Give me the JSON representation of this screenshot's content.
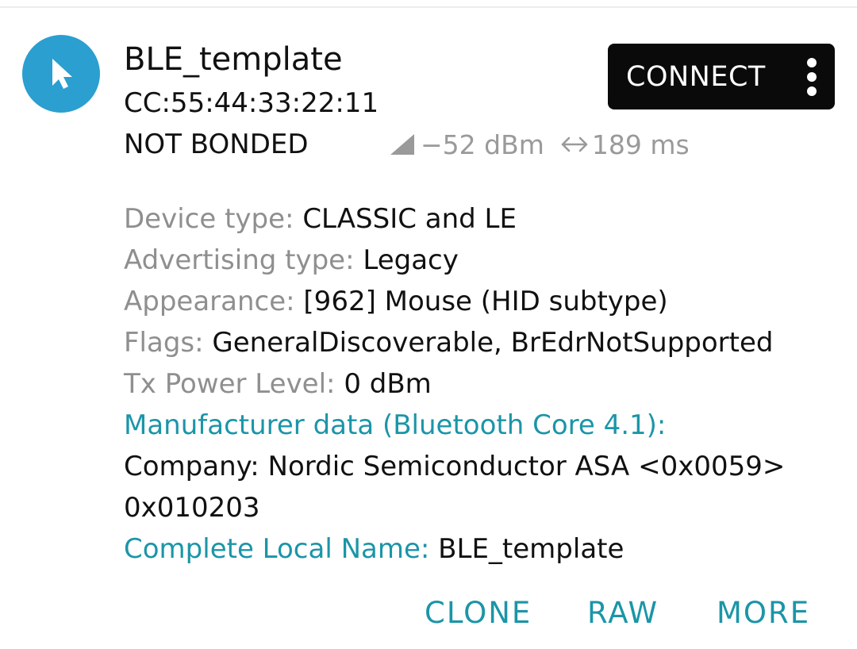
{
  "device": {
    "name": "BLE_template",
    "address": "CC:55:44:33:22:11",
    "bond_state": "NOT BONDED",
    "rssi": "−52 dBm",
    "interval": "189 ms",
    "icon": "cursor-icon",
    "avatar_color": "#2a9fd0"
  },
  "connect": {
    "label": "CONNECT",
    "menu_icon": "more-vert-icon"
  },
  "details": {
    "device_type_label": "Device type:",
    "device_type_value": "CLASSIC and LE",
    "advertising_type_label": "Advertising type:",
    "advertising_type_value": "Legacy",
    "appearance_label": "Appearance:",
    "appearance_value": "[962] Mouse (HID subtype)",
    "flags_label": "Flags:",
    "flags_value": "GeneralDiscoverable, BrEdrNotSupported",
    "tx_power_label": "Tx Power Level:",
    "tx_power_value": "0 dBm",
    "manufacturer_label": "Manufacturer data (Bluetooth Core 4.1):",
    "manufacturer_company": "Company: Nordic Semiconductor ASA <0x0059>",
    "manufacturer_data": "0x010203",
    "local_name_label": "Complete Local Name:",
    "local_name_value": "BLE_template"
  },
  "actions": {
    "clone": "CLONE",
    "raw": "RAW",
    "more": "MORE"
  },
  "colors": {
    "accent": "#1b95a8",
    "label_gray": "#8f8f8f",
    "button_bg": "#0a0a0a"
  }
}
